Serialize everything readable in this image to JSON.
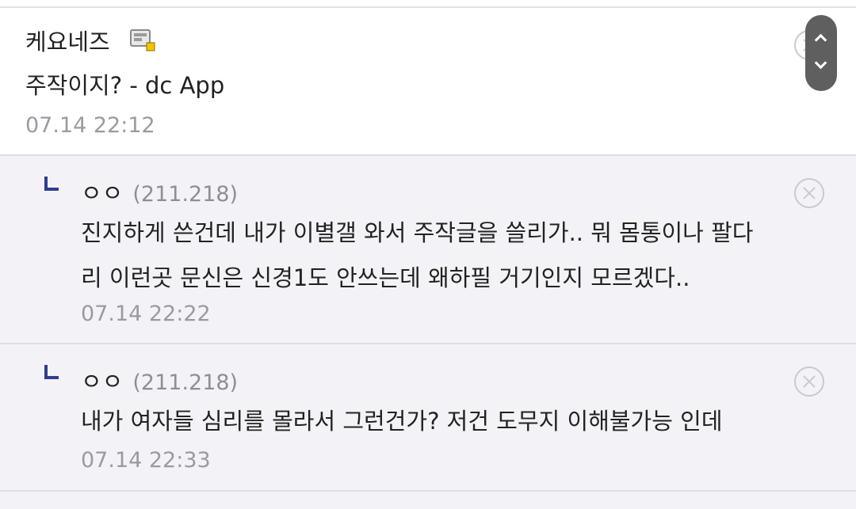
{
  "comment": {
    "nickname": "케요네즈",
    "badge_icon": "fixed-member-icon",
    "text": "주작이지? - dc App",
    "date": "07.14 22:12"
  },
  "replies": [
    {
      "nickname": "ㅇㅇ",
      "ip": "(211.218)",
      "lines": [
        "진지하게 쓴건데 내가 이별갤 와서 주작글을 쓸리가.. 뭐 몸통이나 팔다",
        "리 이런곳 문신은 신경1도 안쓰는데 왜하필 거기인지 모르겠다.."
      ],
      "date": "07.14 22:22"
    },
    {
      "nickname": "ㅇㅇ",
      "ip": "(211.218)",
      "lines": [
        "내가 여자들 심리를 몰라서 그런건가? 저건 도무지 이해불가능 인데"
      ],
      "date": "07.14 22:33"
    }
  ],
  "icons": {
    "delete": "circle-x-icon",
    "reply": "reply-arrow-icon",
    "scroll_up": "chevron-up-icon",
    "scroll_down": "chevron-down-icon"
  },
  "colors": {
    "reply_background": "#f3f3f7",
    "reply_arrow": "#2f3e8c",
    "meta_text": "#9a9aa2",
    "scroll_control": "#5f5f5f"
  }
}
